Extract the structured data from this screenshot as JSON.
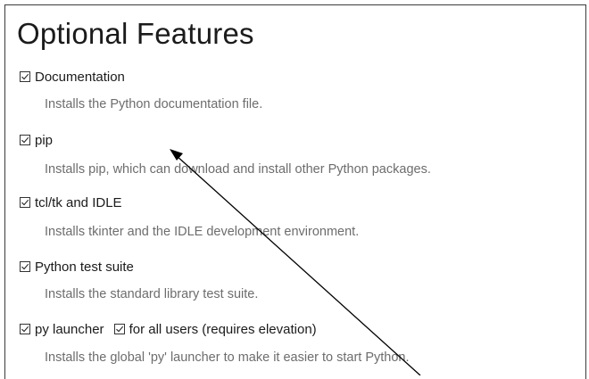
{
  "section": {
    "title": "Optional Features"
  },
  "features": [
    {
      "label": "Documentation",
      "checked": true,
      "description": "Installs the Python documentation file."
    },
    {
      "label": "pip",
      "checked": true,
      "description": "Installs pip, which can download and install other Python packages."
    },
    {
      "label": "tcl/tk and IDLE",
      "checked": true,
      "description": "Installs tkinter and the IDLE development environment."
    },
    {
      "label": "Python test suite",
      "checked": true,
      "description": "Installs the standard library test suite."
    },
    {
      "label": "py launcher",
      "checked": true,
      "extra_option": {
        "label": "for all users (requires elevation)",
        "checked": true
      },
      "description": "Installs the global 'py' launcher to make it easier to start Python."
    }
  ],
  "annotation": {
    "icon": "pointer-arrow",
    "color": "#000000"
  }
}
